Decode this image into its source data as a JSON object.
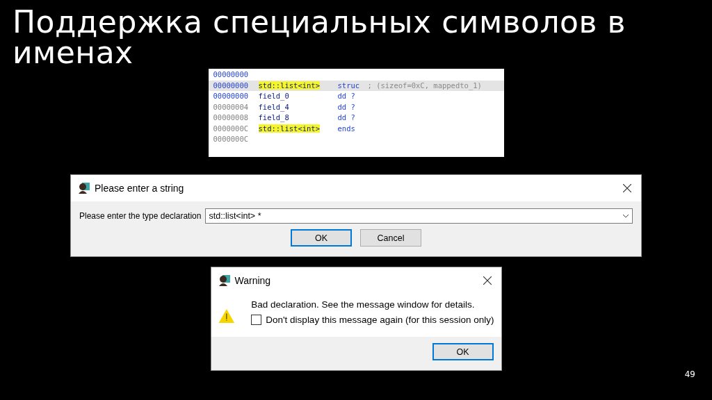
{
  "slide": {
    "title": "Поддержка специальных символов в именах",
    "page_number": "49"
  },
  "listing": {
    "rows": [
      {
        "address": "00000000",
        "color": "#1f3fd8",
        "selected": false
      },
      {
        "address": "00000000",
        "color": "#1f3fd8",
        "selected": true,
        "name": "std::list<int>",
        "highlighted": true,
        "op": "struc",
        "comment": "; (sizeof=0xC, mappedto_1)"
      },
      {
        "address": "00000000",
        "color": "#1f3fd8",
        "selected": false,
        "name": "field_0",
        "highlighted": false,
        "op": "dd ?"
      },
      {
        "address": "00000004",
        "color": "#808080",
        "selected": false,
        "name": "field_4",
        "highlighted": false,
        "op": "dd ?"
      },
      {
        "address": "00000008",
        "color": "#808080",
        "selected": false,
        "name": "field_8",
        "highlighted": false,
        "op": "dd ?"
      },
      {
        "address": "0000000C",
        "color": "#808080",
        "selected": false,
        "name": "std::list<int>",
        "highlighted": true,
        "op": "ends"
      },
      {
        "address": "0000000C",
        "color": "#808080",
        "selected": false
      }
    ]
  },
  "input_dialog": {
    "title": "Please enter a string",
    "label": "Please enter the type declaration",
    "value": "std::list<int> *",
    "buttons": [
      {
        "label": "OK",
        "default": true
      },
      {
        "label": "Cancel",
        "default": false
      }
    ]
  },
  "warning_dialog": {
    "title": "Warning",
    "message": "Bad declaration. See the message window for details.",
    "checkbox": {
      "label": "Don't display this message again (for this session only)",
      "checked": false
    },
    "buttons": [
      {
        "label": "OK",
        "default": true
      }
    ]
  }
}
